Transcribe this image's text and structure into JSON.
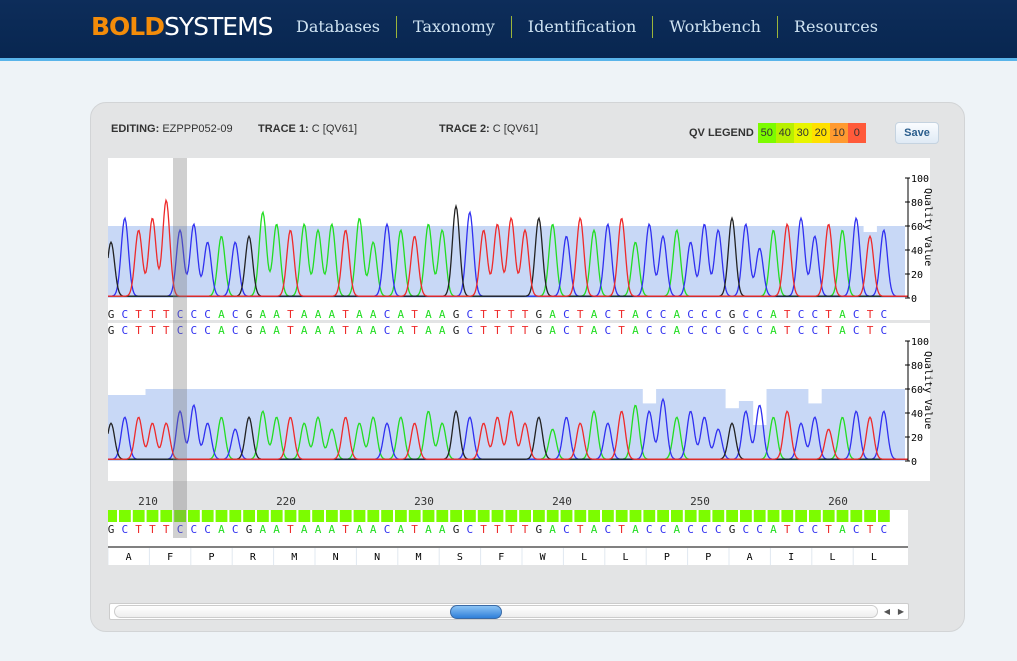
{
  "header": {
    "logo_bold": "BOLD",
    "logo_systems": "SYSTEMS",
    "nav": [
      "Databases",
      "Taxonomy",
      "Identification",
      "Workbench",
      "Resources"
    ]
  },
  "editor": {
    "editing_label": "EDITING:",
    "editing_value": "EZPPP052-09",
    "trace1_label": "TRACE 1:",
    "trace1_value": "C [QV61]",
    "trace2_label": "TRACE 2:",
    "trace2_value": "C [QV61]",
    "legend_label": "QV LEGEND",
    "legend": [
      {
        "v": "50",
        "c": "#7cfc00"
      },
      {
        "v": "40",
        "c": "#b8f000"
      },
      {
        "v": "30",
        "c": "#e8f500"
      },
      {
        "v": "20",
        "c": "#ffe000"
      },
      {
        "v": "10",
        "c": "#ff9a30"
      },
      {
        "v": "0",
        "c": "#ff5a3a"
      }
    ],
    "save_label": "Save",
    "axis_label": "Quality Value",
    "axis_ticks": [
      "0",
      "20",
      "40",
      "60",
      "80",
      "100"
    ],
    "selected_index": 5,
    "base_colors": {
      "A": "#22dd22",
      "C": "#3030f0",
      "G": "#222222",
      "T": "#ee2a2a"
    },
    "sequence": "GCTTTCCCACGAATAAATAACATAAGCTTTTGACTACTACCACCCGCCATCCTACTC",
    "trace1_peaks": [
      45,
      65,
      55,
      65,
      80,
      55,
      60,
      45,
      50,
      45,
      50,
      70,
      60,
      55,
      60,
      55,
      60,
      55,
      65,
      45,
      60,
      55,
      50,
      60,
      55,
      75,
      70,
      55,
      60,
      65,
      55,
      65,
      60,
      50,
      65,
      55,
      60,
      65,
      45,
      60,
      50,
      55,
      45,
      60,
      55,
      65,
      60,
      40,
      55,
      60,
      65,
      50,
      60,
      55,
      65,
      50,
      55,
      60
    ],
    "trace1_qv": [
      60,
      60,
      60,
      60,
      60,
      60,
      60,
      60,
      60,
      60,
      60,
      60,
      60,
      60,
      60,
      60,
      60,
      60,
      60,
      60,
      60,
      60,
      60,
      60,
      60,
      60,
      60,
      60,
      60,
      60,
      60,
      60,
      60,
      60,
      60,
      60,
      60,
      60,
      60,
      60,
      60,
      60,
      60,
      60,
      60,
      60,
      60,
      60,
      60,
      60,
      60,
      60,
      60,
      60,
      60,
      55,
      60,
      60
    ],
    "trace2_peaks": [
      30,
      35,
      35,
      30,
      30,
      40,
      45,
      30,
      35,
      25,
      35,
      40,
      35,
      35,
      30,
      35,
      25,
      35,
      30,
      35,
      30,
      35,
      30,
      40,
      30,
      40,
      35,
      30,
      35,
      40,
      30,
      35,
      25,
      35,
      30,
      40,
      30,
      40,
      45,
      40,
      50,
      35,
      40,
      35,
      25,
      30,
      40,
      45,
      35,
      40,
      30,
      35,
      25,
      35,
      40,
      35,
      40,
      40
    ],
    "trace2_qv": [
      55,
      55,
      55,
      60,
      60,
      60,
      60,
      60,
      60,
      60,
      60,
      60,
      60,
      60,
      60,
      60,
      60,
      60,
      60,
      60,
      60,
      60,
      60,
      60,
      60,
      60,
      60,
      60,
      60,
      60,
      60,
      60,
      60,
      60,
      60,
      60,
      60,
      60,
      60,
      48,
      60,
      60,
      60,
      60,
      60,
      44,
      50,
      30,
      60,
      60,
      60,
      48,
      60,
      60,
      60,
      60,
      60,
      60
    ],
    "positions": [
      "210",
      "220",
      "230",
      "240",
      "250",
      "260"
    ],
    "base_qv_bar": "50",
    "amino_acids": [
      "A",
      "F",
      "P",
      "R",
      "M",
      "N",
      "N",
      "M",
      "S",
      "F",
      "W",
      "L",
      "L",
      "P",
      "P",
      "A",
      "I",
      "L",
      "L"
    ]
  }
}
